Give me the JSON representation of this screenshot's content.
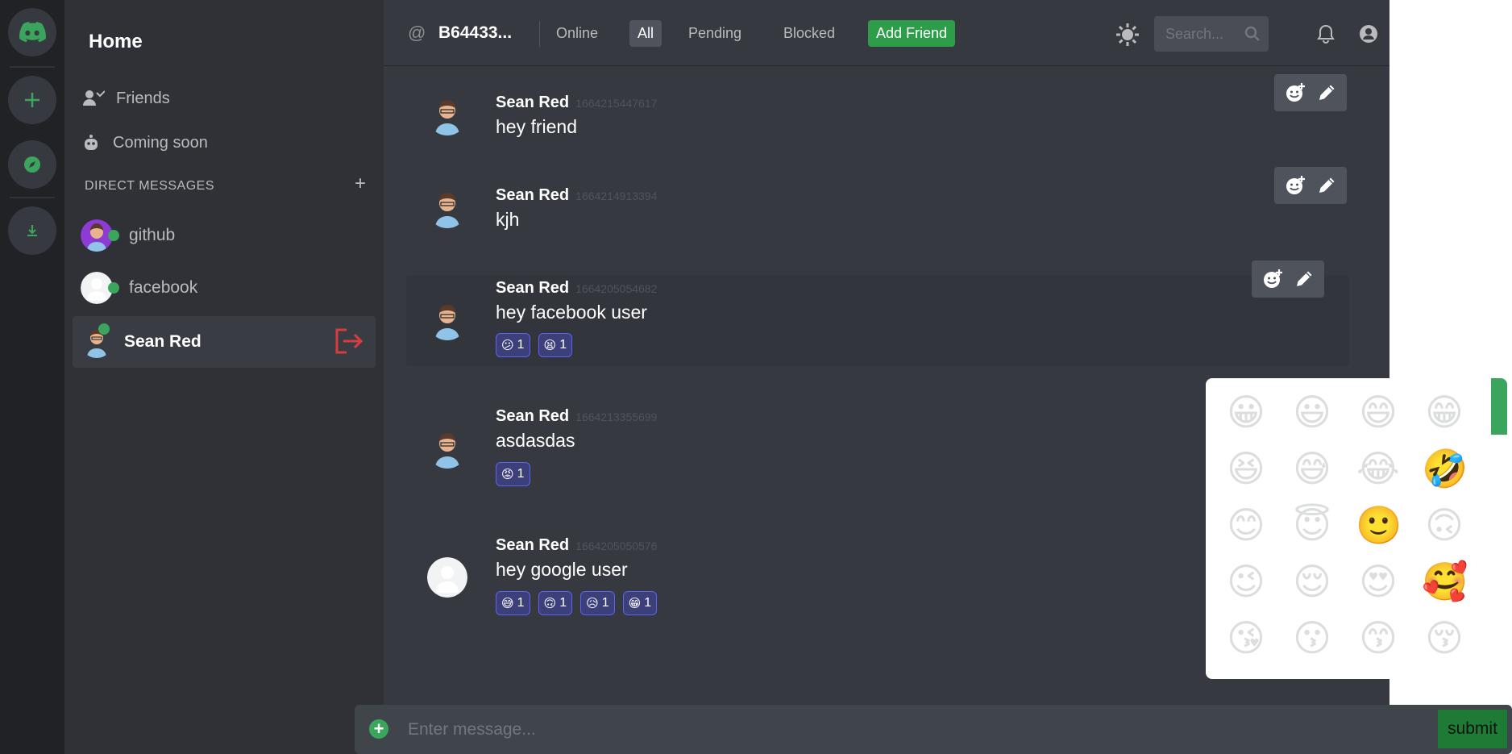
{
  "rail": {
    "items": [
      "discord-logo",
      "add-server",
      "explore",
      "download"
    ]
  },
  "sidebar": {
    "title": "Home",
    "nav": [
      {
        "label": "Friends",
        "icon": "friends-icon"
      },
      {
        "label": "Coming soon",
        "icon": "robot-icon"
      }
    ],
    "dm_header": "DIRECT MESSAGES",
    "dm_add": "+",
    "dms": [
      {
        "name": "github",
        "online": true,
        "active": false
      },
      {
        "name": "facebook",
        "online": true,
        "active": false
      },
      {
        "name": "Sean Red",
        "online": true,
        "active": true
      }
    ]
  },
  "header": {
    "at": "@",
    "channel": "B64433...",
    "tabs": [
      "Online",
      "All",
      "Pending",
      "Blocked"
    ],
    "selected_tab": "All",
    "add_friend": "Add Friend",
    "search_placeholder": "Search..."
  },
  "messages": [
    {
      "author": "Sean Red",
      "time": "1664215447617",
      "text": "hey friend",
      "reactions": []
    },
    {
      "author": "Sean Red",
      "time": "1664214913394",
      "text": "kjh",
      "reactions": []
    },
    {
      "author": "Sean Red",
      "time": "1664205054682",
      "text": "hey facebook user",
      "reactions": [
        {
          "emoji": "😕",
          "count": "1"
        },
        {
          "emoji": "😫",
          "count": "1"
        }
      ]
    },
    {
      "author": "Sean Red",
      "time": "1664213355699",
      "text": "asdasdas",
      "reactions": [
        {
          "emoji": "😡",
          "count": "1"
        }
      ]
    },
    {
      "author": "Sean Red",
      "time": "1664205050576",
      "text": "hey google user",
      "reactions": [
        {
          "emoji": "😅",
          "count": "1"
        },
        {
          "emoji": "🙃",
          "count": "1"
        },
        {
          "emoji": "😥",
          "count": "1"
        },
        {
          "emoji": "😁",
          "count": "1"
        }
      ]
    }
  ],
  "picker": {
    "emojis": [
      "😀",
      "😃",
      "😄",
      "😁",
      "😆",
      "😅",
      "😂",
      "🤣",
      "😊",
      "😇",
      "🙂",
      "🙃",
      "😉",
      "😌",
      "😍",
      "🥰",
      "😘",
      "😗",
      "😙",
      "😚"
    ]
  },
  "composer": {
    "placeholder": "Enter message...",
    "submit": "submit"
  },
  "colors": {
    "accent_green": "#3ba55d",
    "add_friend_green": "#2d9d4a",
    "reaction_border": "#5865f2",
    "logout_red": "#d83c3e"
  }
}
